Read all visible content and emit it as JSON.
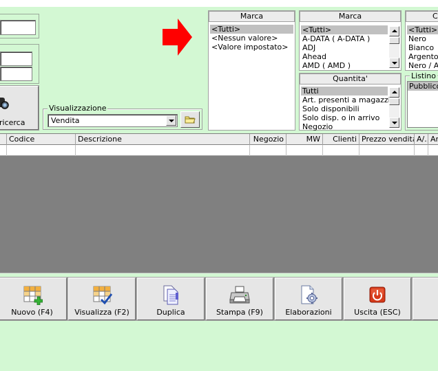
{
  "left_panel": {
    "search_button_label": "ricerca"
  },
  "view_group": {
    "title": "Visualizzazione",
    "selected": "Vendita"
  },
  "filter_marca_1": {
    "title": "Marca",
    "items": [
      "<Tutti>",
      "<Nessun valore>",
      "<Valore impostato>"
    ],
    "selected_index": 0
  },
  "filter_marca_2": {
    "title": "Marca",
    "items": [
      "<Tutti>",
      "A-DATA ( A-DATA )",
      "ADJ",
      "Ahead",
      "AMD ( AMD )"
    ],
    "selected_index": 0
  },
  "filter_quantita": {
    "title": "Quantita'",
    "items": [
      "Tutti",
      "Art. presenti a magazzino",
      "Solo disponibili",
      "Solo disp. o in arrivo",
      "Negozio"
    ],
    "selected_index": 0
  },
  "filter_colore": {
    "title": "Co",
    "items": [
      "<Tutti>",
      "Nero",
      "Bianco",
      "Argento",
      "Nero / Ar"
    ],
    "selected_index": 0
  },
  "listino": {
    "title": "Listino",
    "items": [
      "Pubblico"
    ],
    "selected_index": 0
  },
  "grid": {
    "columns": [
      "Codice",
      "Descrizione",
      "Negozio",
      "MW",
      "Clienti",
      "Prezzo vendita",
      "A/..",
      "Ar"
    ]
  },
  "toolbar": {
    "nuovo": "Nuovo (F4)",
    "visualizza": "Visualizza (F2)",
    "duplica": "Duplica",
    "stampa": "Stampa (F9)",
    "elaborazioni": "Elaborazioni",
    "uscita": "Uscita (ESC)"
  },
  "colors": {
    "background": "#d3f8d3",
    "arrow": "#ff0000",
    "grid_area": "#808080"
  }
}
